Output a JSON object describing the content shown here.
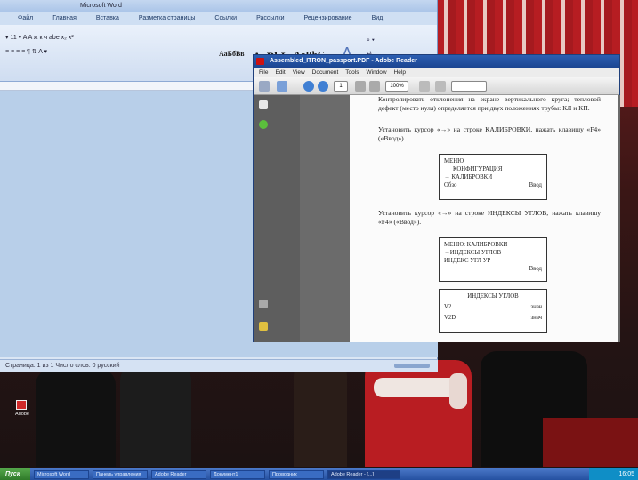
{
  "word": {
    "title": "Microsoft Word",
    "tabs": [
      "Файл",
      "Главная",
      "Вставка",
      "Разметка страницы",
      "Ссылки",
      "Рассылки",
      "Рецензирование",
      "Вид"
    ],
    "styles": [
      "АаБбВв",
      "АаBbI",
      "AaBbC"
    ],
    "status": "Страница: 1 из 1    Число слов: 0    русский"
  },
  "adobe": {
    "title": "Assembled_ITRON_passport.PDF - Adobe Reader",
    "menu": [
      "File",
      "Edit",
      "View",
      "Document",
      "Tools",
      "Window",
      "Help"
    ],
    "zoom": "100%",
    "page_field": "1",
    "doc": {
      "para1": "Контролировать отклонения на экране вертикального круга; тепловой дефект (место нуля) определяется при двух положениях трубы: КЛ и КП.",
      "para2": "Установить курсор «→» на строке КАЛИБРОВКИ, нажать клавишу «F4» («Ввод»).",
      "menu_box": {
        "title": "МЕНЮ",
        "items": [
          "КОНФИГУРАЦИЯ",
          "→ КАЛИБРОВКИ"
        ],
        "footer_left": "Обзо",
        "footer_right": "Ввод"
      },
      "para3": "Установить курсор «→» на строке ИНДЕКСЫ УГЛОВ, нажать клавишу «F4» («Ввод»).",
      "calib_box": {
        "items": [
          "МЕНЮ: КАЛИБРОВКИ",
          "→ИНДЕКСЫ УГЛОВ",
          " ИНДЕКС УГЛ УР"
        ],
        "footer_right": "Ввод"
      },
      "index_box": {
        "title": "ИНДЕКСЫ УГЛОВ",
        "rows": [
          {
            "left": "V2",
            "right": "знач"
          },
          {
            "left": "V2D",
            "right": "знач"
          }
        ]
      }
    }
  },
  "taskbar": {
    "start": "Пуск",
    "buttons": [
      "Microsoft Word",
      "Панель управления",
      "Adobe Reader",
      "Документ1",
      "Проводник",
      "Adobe Reader - [...]"
    ],
    "clock": "16:05"
  },
  "desktop": {
    "icon_label": "Adobe"
  }
}
